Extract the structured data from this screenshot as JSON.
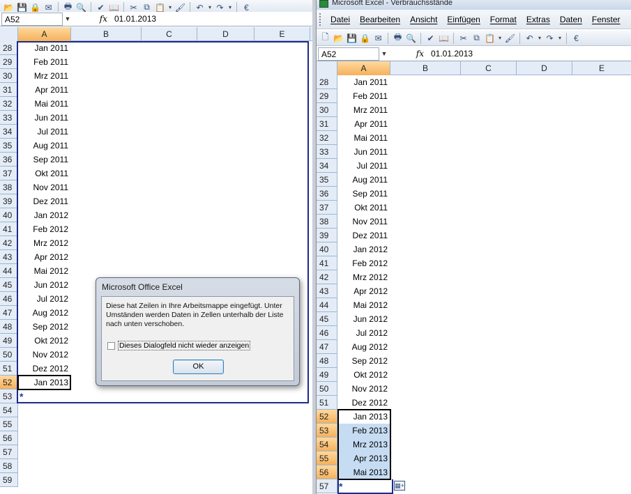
{
  "left_window": {
    "name_box": "A52",
    "fx_label": "fx",
    "formula_value": "01.01.2013",
    "columns": [
      "A",
      "B",
      "C",
      "D",
      "E"
    ],
    "rows": [
      {
        "num": "28",
        "a": "Jan 2011"
      },
      {
        "num": "29",
        "a": "Feb 2011"
      },
      {
        "num": "30",
        "a": "Mrz 2011"
      },
      {
        "num": "31",
        "a": "Apr 2011"
      },
      {
        "num": "32",
        "a": "Mai 2011"
      },
      {
        "num": "33",
        "a": "Jun 2011"
      },
      {
        "num": "34",
        "a": "Jul 2011"
      },
      {
        "num": "35",
        "a": "Aug 2011"
      },
      {
        "num": "36",
        "a": "Sep 2011"
      },
      {
        "num": "37",
        "a": "Okt 2011"
      },
      {
        "num": "38",
        "a": "Nov 2011"
      },
      {
        "num": "39",
        "a": "Dez 2011"
      },
      {
        "num": "40",
        "a": "Jan 2012"
      },
      {
        "num": "41",
        "a": "Feb 2012"
      },
      {
        "num": "42",
        "a": "Mrz 2012"
      },
      {
        "num": "43",
        "a": "Apr 2012"
      },
      {
        "num": "44",
        "a": "Mai 2012"
      },
      {
        "num": "45",
        "a": "Jun 2012"
      },
      {
        "num": "46",
        "a": "Jul 2012"
      },
      {
        "num": "47",
        "a": "Aug 2012"
      },
      {
        "num": "48",
        "a": "Sep 2012"
      },
      {
        "num": "49",
        "a": "Okt 2012"
      },
      {
        "num": "50",
        "a": "Nov 2012"
      },
      {
        "num": "51",
        "a": "Dez 2012"
      },
      {
        "num": "52",
        "a": "Jan 2013"
      },
      {
        "num": "53",
        "a": "*"
      },
      {
        "num": "54",
        "a": ""
      },
      {
        "num": "55",
        "a": ""
      },
      {
        "num": "56",
        "a": ""
      },
      {
        "num": "57",
        "a": ""
      },
      {
        "num": "58",
        "a": ""
      },
      {
        "num": "59",
        "a": ""
      }
    ]
  },
  "right_window": {
    "title": "Microsoft Excel - Verbrauchsstände",
    "menu": [
      "Datei",
      "Bearbeiten",
      "Ansicht",
      "Einfügen",
      "Format",
      "Extras",
      "Daten",
      "Fenster"
    ],
    "name_box": "A52",
    "fx_label": "fx",
    "formula_value": "01.01.2013",
    "columns": [
      "A",
      "B",
      "C",
      "D",
      "E"
    ],
    "rows": [
      {
        "num": "28",
        "a": "Jan 2011"
      },
      {
        "num": "29",
        "a": "Feb 2011"
      },
      {
        "num": "30",
        "a": "Mrz 2011"
      },
      {
        "num": "31",
        "a": "Apr 2011"
      },
      {
        "num": "32",
        "a": "Mai 2011"
      },
      {
        "num": "33",
        "a": "Jun 2011"
      },
      {
        "num": "34",
        "a": "Jul 2011"
      },
      {
        "num": "35",
        "a": "Aug 2011"
      },
      {
        "num": "36",
        "a": "Sep 2011"
      },
      {
        "num": "37",
        "a": "Okt 2011"
      },
      {
        "num": "38",
        "a": "Nov 2011"
      },
      {
        "num": "39",
        "a": "Dez 2011"
      },
      {
        "num": "40",
        "a": "Jan 2012"
      },
      {
        "num": "41",
        "a": "Feb 2012"
      },
      {
        "num": "42",
        "a": "Mrz 2012"
      },
      {
        "num": "43",
        "a": "Apr 2012"
      },
      {
        "num": "44",
        "a": "Mai 2012"
      },
      {
        "num": "45",
        "a": "Jun 2012"
      },
      {
        "num": "46",
        "a": "Jul 2012"
      },
      {
        "num": "47",
        "a": "Aug 2012"
      },
      {
        "num": "48",
        "a": "Sep 2012"
      },
      {
        "num": "49",
        "a": "Okt 2012"
      },
      {
        "num": "50",
        "a": "Nov 2012"
      },
      {
        "num": "51",
        "a": "Dez 2012"
      },
      {
        "num": "52",
        "a": "Jan 2013"
      },
      {
        "num": "53",
        "a": "Feb 2013"
      },
      {
        "num": "54",
        "a": "Mrz 2013"
      },
      {
        "num": "55",
        "a": "Apr 2013"
      },
      {
        "num": "56",
        "a": "Mai 2013"
      },
      {
        "num": "57",
        "a": "*"
      }
    ]
  },
  "dialog": {
    "title": "Microsoft Office Excel",
    "message": "Diese hat Zeilen in Ihre Arbeitsmappe eingefügt. Unter Umständen werden Daten in Zellen unterhalb der Liste nach unten verschoben.",
    "checkbox_label": "Dieses Dialogfeld nicht wieder anzeigen",
    "checkbox_checked": false,
    "ok_label": "OK"
  },
  "colors": {
    "list_border": "#1d2a8c",
    "active_header": "#f5b15a",
    "selection_fill": "#c6dcf3",
    "header_fill": "#e4ecf7"
  }
}
